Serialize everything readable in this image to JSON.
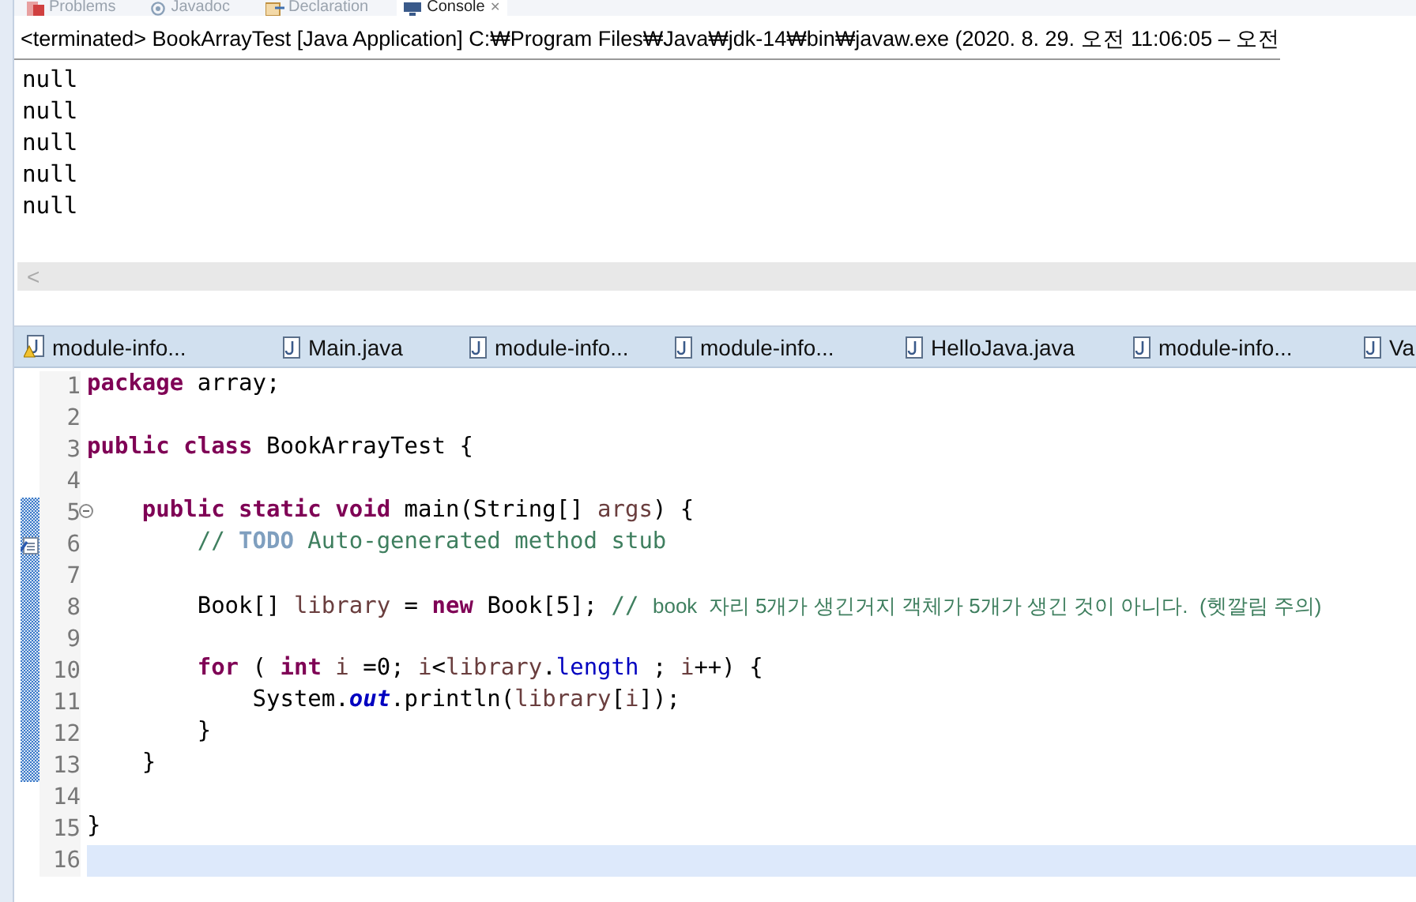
{
  "view_tabs": [
    {
      "label": "Problems",
      "selected": false
    },
    {
      "label": "Javadoc",
      "selected": false
    },
    {
      "label": "Declaration",
      "selected": false
    },
    {
      "label": "Console",
      "selected": true,
      "close": "✕"
    }
  ],
  "console": {
    "header": "<terminated> BookArrayTest [Java Application] C:₩Program Files₩Java₩jdk-14₩bin₩javaw.exe  (2020. 8. 29. 오전 11:06:05 – 오전",
    "output": [
      "null",
      "null",
      "null",
      "null",
      "null"
    ],
    "scroll_arrow": "<"
  },
  "editor_tabs": [
    {
      "label": "module-info...",
      "warning": true,
      "selected": false
    },
    {
      "label": "Main.java",
      "warning": false,
      "selected": false
    },
    {
      "label": "module-info...",
      "warning": false,
      "selected": false
    },
    {
      "label": "module-info...",
      "warning": false,
      "selected": false
    },
    {
      "label": "HelloJava.java",
      "warning": false,
      "selected": false
    },
    {
      "label": "module-info...",
      "warning": false,
      "selected": false
    },
    {
      "label": "Va",
      "warning": false,
      "selected": false
    }
  ],
  "lines": [
    {
      "number": "1",
      "changed": false,
      "current": false,
      "folding": false,
      "task": false,
      "segments": [
        {
          "kind": "keyword",
          "text": "package"
        },
        {
          "kind": "plain",
          "text": " array;"
        }
      ]
    },
    {
      "number": "2",
      "changed": false,
      "current": false,
      "folding": false,
      "task": false
    },
    {
      "number": "3",
      "changed": false,
      "current": false,
      "folding": false,
      "task": false,
      "segments": [
        {
          "kind": "keyword",
          "text": "public class"
        },
        {
          "kind": "plain",
          "text": " BookArrayTest {"
        }
      ]
    },
    {
      "number": "4",
      "changed": false,
      "current": false,
      "folding": false,
      "task": false
    },
    {
      "number": "5",
      "changed": true,
      "current": false,
      "folding": true,
      "task": false,
      "segments": [
        {
          "kind": "keyword",
          "text": "    public static void"
        },
        {
          "kind": "plain",
          "text": " main(String[] "
        },
        {
          "kind": "variable",
          "text": "args"
        },
        {
          "kind": "plain",
          "text": ") {"
        }
      ]
    },
    {
      "number": "6",
      "changed": true,
      "current": false,
      "folding": false,
      "task": true,
      "segments": [
        {
          "kind": "comment",
          "text": "        // "
        },
        {
          "kind": "todo",
          "text": "TODO"
        },
        {
          "kind": "comment",
          "text": " Auto-generated method stub"
        }
      ]
    },
    {
      "number": "7",
      "changed": true,
      "current": false,
      "folding": false,
      "task": false
    },
    {
      "number": "8",
      "changed": true,
      "current": false,
      "folding": false,
      "task": false,
      "segments": [
        {
          "kind": "plain",
          "text": "        Book[] "
        },
        {
          "kind": "variable",
          "text": "library"
        },
        {
          "kind": "plain",
          "text": " = "
        },
        {
          "kind": "keyword",
          "text": "new"
        },
        {
          "kind": "plain",
          "text": " Book[5]; "
        },
        {
          "kind": "comment",
          "text": "// "
        },
        {
          "kind": "comment_sans",
          "text": "book  자리 5개가 생긴거지 객체가 5개가 생긴 것이 아니다.  (헷깔림 주의)"
        }
      ]
    },
    {
      "number": "9",
      "changed": true,
      "current": false,
      "folding": false,
      "task": false
    },
    {
      "number": "10",
      "changed": true,
      "current": false,
      "folding": false,
      "task": false,
      "segments": [
        {
          "kind": "keyword",
          "text": "        for"
        },
        {
          "kind": "plain",
          "text": " ( "
        },
        {
          "kind": "keyword",
          "text": "int "
        },
        {
          "kind": "variable",
          "text": "i"
        },
        {
          "kind": "plain",
          "text": " =0; "
        },
        {
          "kind": "variable",
          "text": "i"
        },
        {
          "kind": "plain",
          "text": "<"
        },
        {
          "kind": "variable",
          "text": "library"
        },
        {
          "kind": "plain",
          "text": "."
        },
        {
          "kind": "field",
          "text": "length"
        },
        {
          "kind": "plain",
          "text": " ; "
        },
        {
          "kind": "variable",
          "text": "i"
        },
        {
          "kind": "plain",
          "text": "++) {"
        }
      ]
    },
    {
      "number": "11",
      "changed": true,
      "current": false,
      "folding": false,
      "task": false,
      "segments": [
        {
          "kind": "plain",
          "text": "            System."
        },
        {
          "kind": "static_field",
          "text": "out"
        },
        {
          "kind": "plain",
          "text": ".println("
        },
        {
          "kind": "variable",
          "text": "library"
        },
        {
          "kind": "plain",
          "text": "["
        },
        {
          "kind": "variable",
          "text": "i"
        },
        {
          "kind": "plain",
          "text": "]);"
        }
      ]
    },
    {
      "number": "12",
      "changed": true,
      "current": false,
      "folding": false,
      "task": false,
      "segments": [
        {
          "kind": "plain",
          "text": "        }"
        }
      ]
    },
    {
      "number": "13",
      "changed": true,
      "current": false,
      "folding": false,
      "task": false,
      "segments": [
        {
          "kind": "plain",
          "text": "    }"
        }
      ]
    },
    {
      "number": "14",
      "changed": false,
      "current": false,
      "folding": false,
      "task": false
    },
    {
      "number": "15",
      "changed": false,
      "current": false,
      "folding": false,
      "task": false,
      "segments": [
        {
          "kind": "plain",
          "text": "}"
        }
      ]
    },
    {
      "number": "16",
      "changed": false,
      "current": true,
      "folding": false,
      "task": false
    }
  ]
}
